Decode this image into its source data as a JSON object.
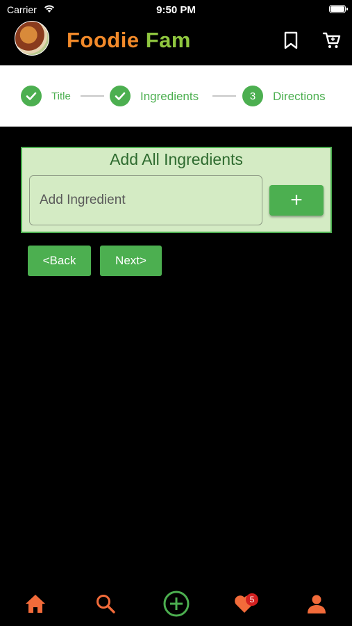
{
  "status_bar": {
    "carrier": "Carrier",
    "time": "9:50 PM"
  },
  "app_bar": {
    "brand_word1": "Foodie",
    "brand_word2": "Fam"
  },
  "stepper": {
    "steps": [
      {
        "label": "Title",
        "state": "done"
      },
      {
        "label": "Ingredients",
        "state": "done"
      },
      {
        "number": "3",
        "label": "Directions",
        "state": "current"
      }
    ]
  },
  "card": {
    "title": "Add All Ingredients",
    "input_placeholder": "Add Ingredient",
    "input_value": "",
    "add_label": "+"
  },
  "nav_buttons": {
    "back": "<Back",
    "next": "Next>"
  },
  "bottom_nav": {
    "items": [
      "home-icon",
      "search-icon",
      "add-circle-icon",
      "favorites-icon",
      "profile-icon"
    ],
    "favorites_badge": "5"
  },
  "colors": {
    "accent_green": "#4caf50",
    "brand_orange": "#f28a2a",
    "brand_green": "#8fc63f",
    "nav_orange": "#f26b3a",
    "badge_red": "#d32020"
  }
}
